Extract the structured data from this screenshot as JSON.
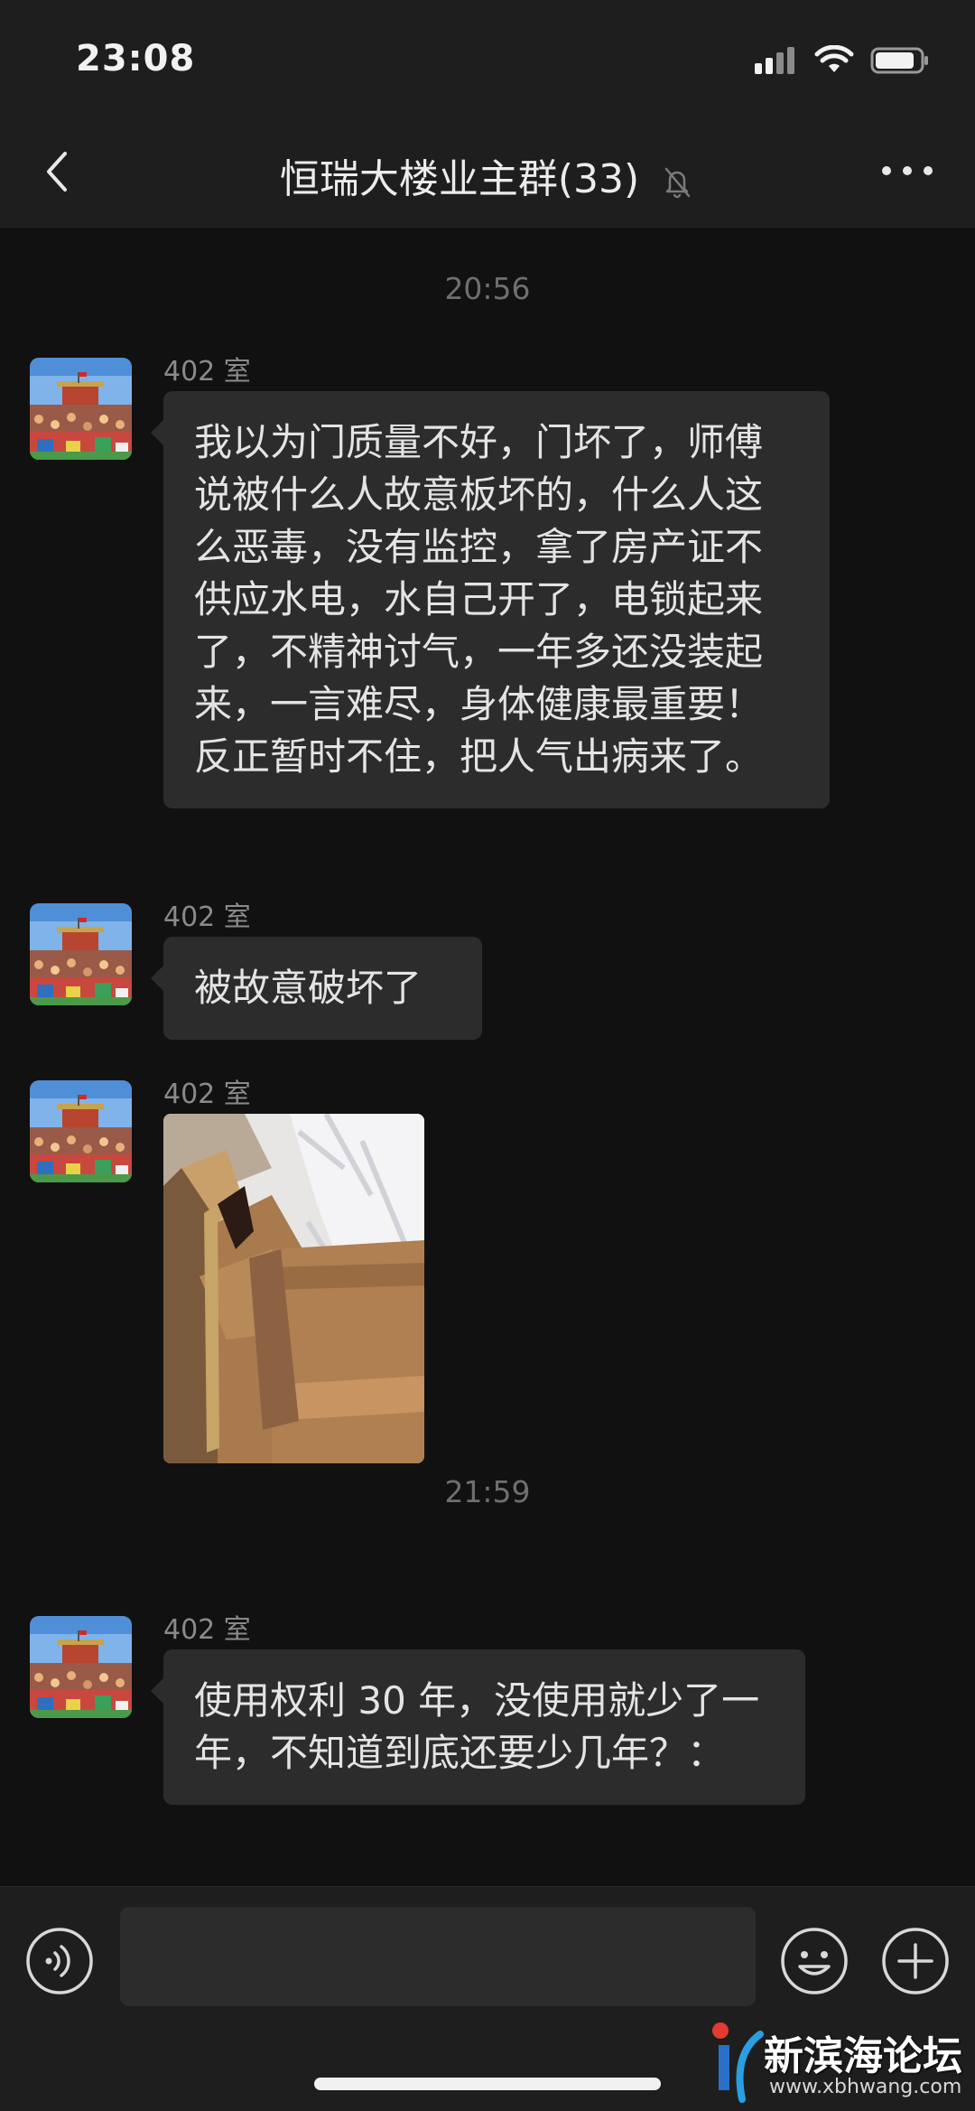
{
  "status_bar": {
    "time": "23:08"
  },
  "header": {
    "title": "恒瑞大楼业主群(33)"
  },
  "chat": {
    "separators": [
      "20:56",
      "21:59"
    ],
    "messages": [
      {
        "sender": "402 室",
        "text": "我以为门质量不好，门坏了，师傅说被什么人故意板坏的，什么人这么恶毒，没有监控，拿了房产证不供应水电，水自己开了，电锁起来了，不精神讨气，一年多还没装起来，一言难尽，身体健康最重要！反正暂时不住，把人气出病来了。"
      },
      {
        "sender": "402 室",
        "text": "被故意破坏了"
      },
      {
        "sender": "402 室",
        "image": "broken-door-hinge-photo"
      },
      {
        "sender": "402 室",
        "text": "使用权利 30 年，没使用就少了一年，不知道到底还要少几年？："
      }
    ]
  },
  "input_bar": {
    "value": "",
    "placeholder": ""
  },
  "watermark": {
    "name": "新滨海论坛",
    "url": "www.xbhwang.com"
  },
  "colors": {
    "background": "#111111",
    "bar": "#1e1e1e",
    "bubble": "#2c2c2c"
  }
}
